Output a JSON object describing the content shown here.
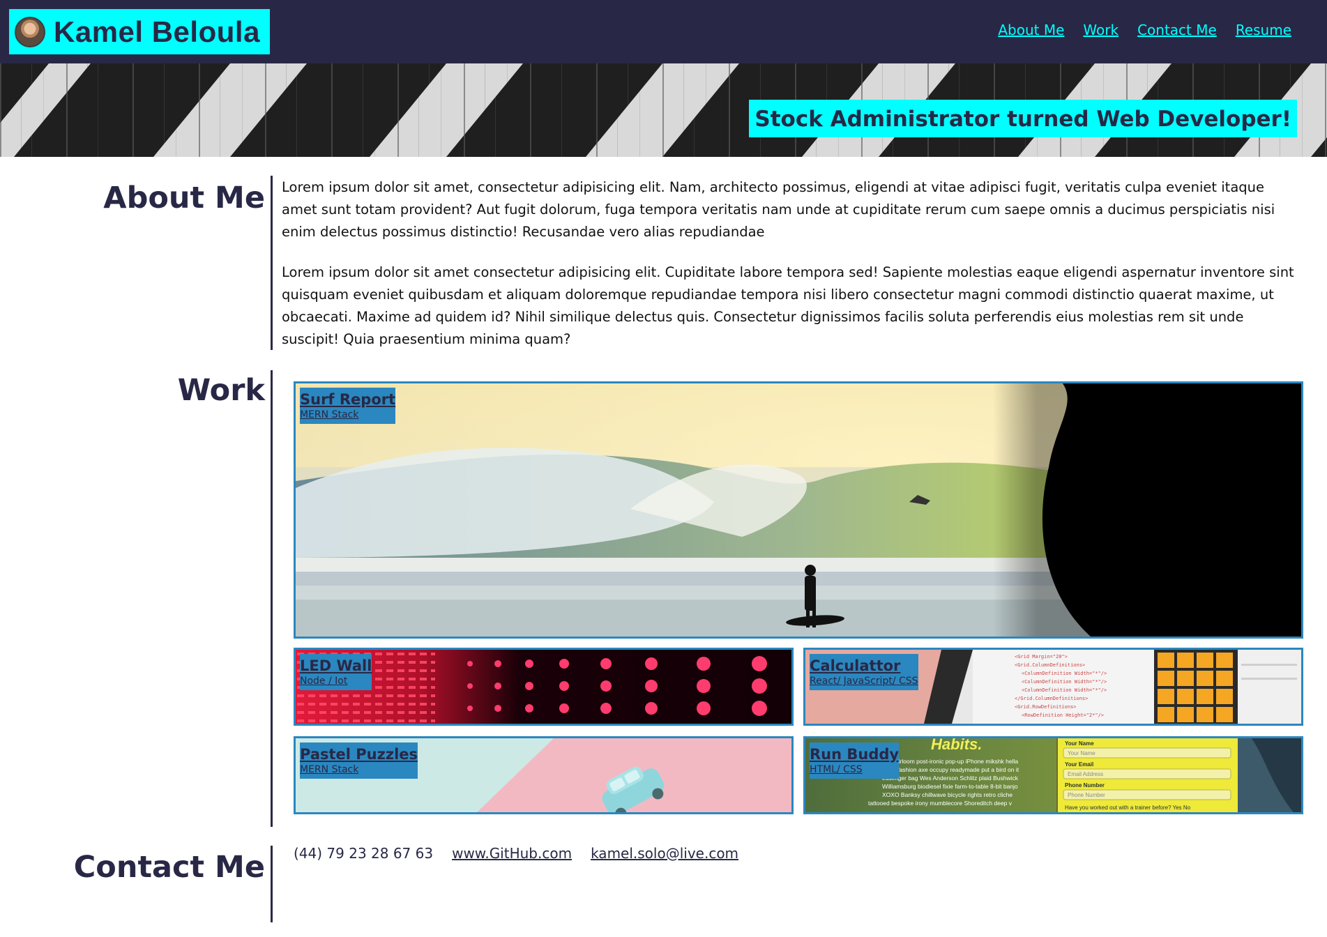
{
  "header": {
    "name": "Kamel Beloula",
    "nav": [
      "About Me",
      "Work",
      "Contact Me",
      "Resume"
    ]
  },
  "hero": {
    "tagline": "Stock Administrator turned Web Developer!"
  },
  "about": {
    "title": "About Me",
    "paragraphs": [
      "Lorem ipsum dolor sit amet, consectetur adipisicing elit. Nam, architecto possimus, eligendi at vitae adipisci fugit, veritatis culpa eveniet itaque amet sunt totam provident? Aut fugit dolorum, fuga tempora veritatis nam unde at cupiditate rerum cum saepe omnis a ducimus perspiciatis nisi enim delectus possimus distinctio! Recusandae vero alias repudiandae",
      "Lorem ipsum dolor sit amet consectetur adipisicing elit. Cupiditate labore tempora sed! Sapiente molestias eaque eligendi aspernatur inventore sint quisquam eveniet quibusdam et aliquam doloremque repudiandae tempora nisi libero consectetur magni commodi distinctio quaerat maxime, ut obcaecati. Maxime ad quidem id? Nihil similique delectus quis. Consectetur dignissimos facilis soluta perferendis eius molestias rem sit unde suscipit! Quia praesentium minima quam?"
    ]
  },
  "work": {
    "title": "Work",
    "projects": [
      {
        "title": "Surf Report",
        "stack": "MERN Stack"
      },
      {
        "title": "LED Wall",
        "stack": "Node / Iot"
      },
      {
        "title": "Calculattor",
        "stack": "React/ JavaScript/ CSS"
      },
      {
        "title": "Pastel Puzzles",
        "stack": "MERN Stack"
      },
      {
        "title": "Run Buddy",
        "stack": "HTML/ CSS"
      }
    ]
  },
  "contact": {
    "title": "Contact Me",
    "phone": "(44) 79 23 28 67 63",
    "github": "www.GitHub.com",
    "email": "kamel.solo@live.com"
  },
  "colors": {
    "navy": "#282846",
    "cyan": "#00ffff",
    "card_blue": "#2b87bf"
  }
}
